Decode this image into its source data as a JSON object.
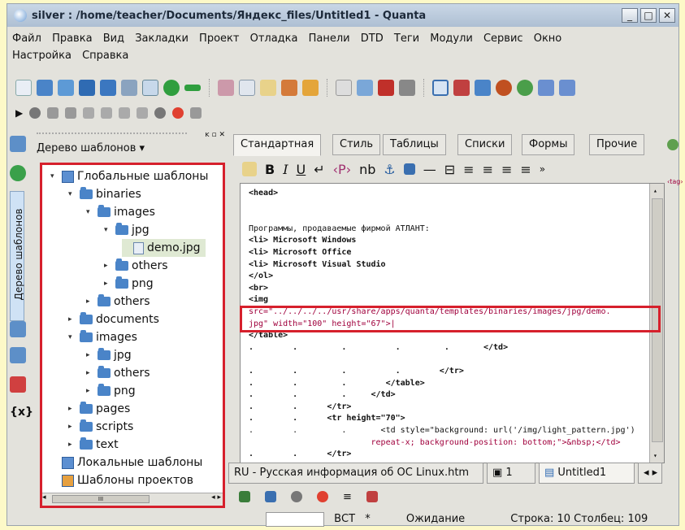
{
  "window": {
    "title": "silver : /home/teacher/Documents/Яндекс_files/Untitled1 - Quanta"
  },
  "menu": [
    "Файл",
    "Правка",
    "Вид",
    "Закладки",
    "Проект",
    "Отладка",
    "Панели",
    "DTD",
    "Теги",
    "Модули",
    "Сервис",
    "Окно",
    "Настройка",
    "Справка"
  ],
  "left_panel": {
    "vertical_tab": "Дерево шаблонов",
    "combo": "Дерево шаблонов",
    "tree": [
      {
        "label": "Глобальные шаблоны",
        "level": 0,
        "expanded": true,
        "type": "root"
      },
      {
        "label": "binaries",
        "level": 1,
        "expanded": true,
        "type": "folder"
      },
      {
        "label": "images",
        "level": 2,
        "expanded": true,
        "type": "folder"
      },
      {
        "label": "jpg",
        "level": 3,
        "expanded": true,
        "type": "folder"
      },
      {
        "label": "demo.jpg",
        "level": 4,
        "type": "file",
        "selected": true
      },
      {
        "label": "others",
        "level": 3,
        "expanded": false,
        "type": "folder"
      },
      {
        "label": "png",
        "level": 3,
        "expanded": false,
        "type": "folder"
      },
      {
        "label": "others",
        "level": 2,
        "expanded": false,
        "type": "folder"
      },
      {
        "label": "documents",
        "level": 1,
        "expanded": false,
        "type": "folder"
      },
      {
        "label": "images",
        "level": 1,
        "expanded": true,
        "type": "folder"
      },
      {
        "label": "jpg",
        "level": 2,
        "expanded": false,
        "type": "folder"
      },
      {
        "label": "others",
        "level": 2,
        "expanded": false,
        "type": "folder"
      },
      {
        "label": "png",
        "level": 2,
        "expanded": false,
        "type": "folder"
      },
      {
        "label": "pages",
        "level": 1,
        "expanded": false,
        "type": "folder"
      },
      {
        "label": "scripts",
        "level": 1,
        "expanded": false,
        "type": "folder"
      },
      {
        "label": "text",
        "level": 1,
        "expanded": false,
        "type": "folder"
      },
      {
        "label": "Локальные шаблоны",
        "level": 0,
        "type": "root"
      },
      {
        "label": "Шаблоны проектов",
        "level": 0,
        "type": "root2"
      }
    ],
    "hscroll_glyph": "III"
  },
  "toolbar_tabs": [
    "Стандартная",
    "Стиль",
    "Таблицы",
    "Списки",
    "Формы",
    "Прочие"
  ],
  "format_bar": {
    "bold": "B",
    "italic": "I",
    "underline": "U",
    "nbsp": "nb"
  },
  "editor": {
    "lines": [
      "<head>",
      "",
      "",
      "Программы, продаваемые фирмой АТЛАНТ:",
      "<li> Microsoft Windows",
      "<li> Microsoft Office",
      "<li> Microsoft Visual Studio",
      "</ol>",
      "<br>",
      "<img",
      "src=\"../../../../usr/share/apps/quanta/templates/binaries/images/jpg/demo.",
      "jpg\" width=\"100\" height=\"67\">|",
      "</table>",
      ".        .         .          .         .       </td>",
      "",
      ".        .         .          .        </tr>",
      ".        .         .        </table>",
      ".        .         .     </td>",
      ".        .      </tr>",
      ".        .      <tr height=\"70\">",
      ".        .         .       <td style=\"background: url('/img/light_pattern.jpg')",
      "                         repeat-x; background-position: bottom;\">&nbsp;</td>",
      ".        .      </tr>"
    ]
  },
  "doc_tabs": [
    "RU - Русская информация об ОС Linux.htm",
    "1",
    "Untitled1"
  ],
  "status": {
    "mode": "ВСТ",
    "modified": "*",
    "state": "Ожидание",
    "position": "Строка: 10 Столбец: 109"
  },
  "right_bar": {
    "tag_label": "tag"
  }
}
